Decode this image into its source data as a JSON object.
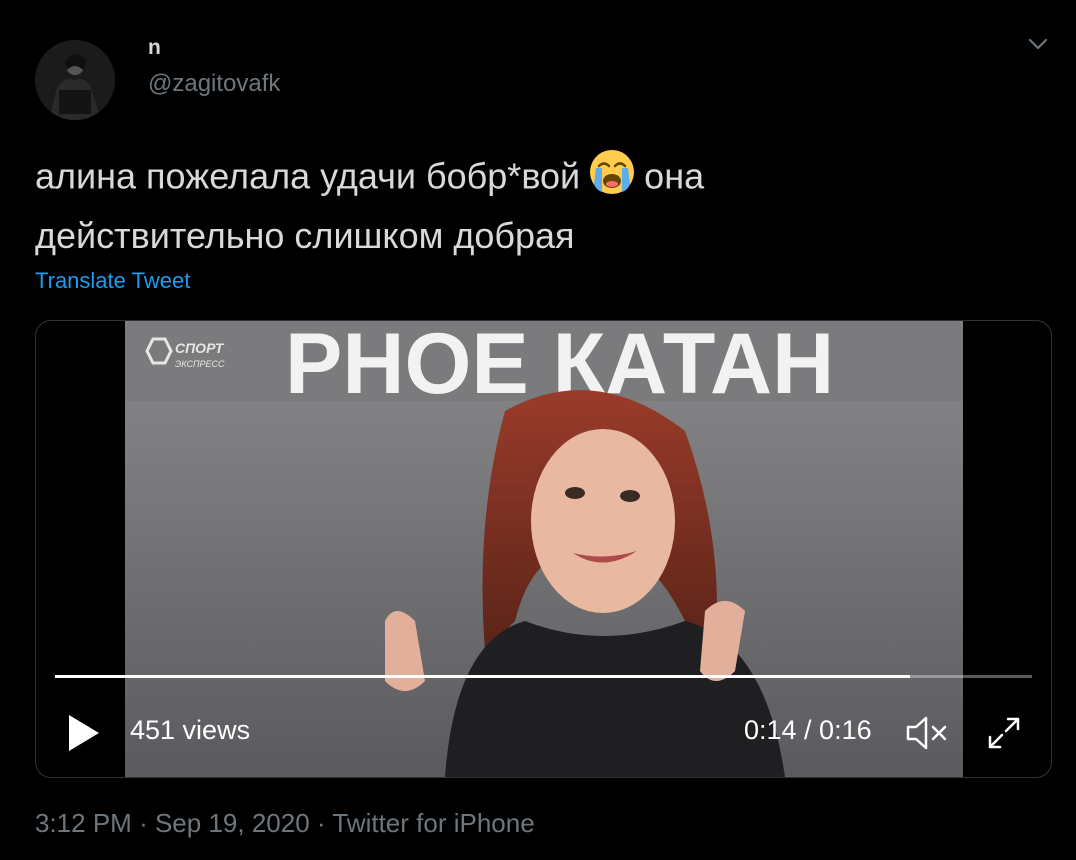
{
  "author": {
    "display_name": "n",
    "handle": "@zagitovafk"
  },
  "tweet": {
    "line1_before": "алина пожелала удачи бобр*вой",
    "emoji": "loudly-crying-face-icon",
    "line1_after": "она",
    "line2": "действительно слишком добрая",
    "translate_label": "Translate Tweet"
  },
  "video": {
    "views_label": "451 views",
    "time_label": "0:14 / 0:16",
    "progress": 0.875,
    "overlay_text": "РНОЕ КАТАН",
    "logo_line1": "СПОРТ",
    "logo_line2": "ЭКСПРЕСС"
  },
  "meta": {
    "time": "3:12 PM",
    "date": "Sep 19, 2020",
    "source": "Twitter for iPhone",
    "separator": "·"
  },
  "colors": {
    "link": "#1d9bf0",
    "secondary": "#6e767d",
    "text": "#d9d9d9"
  }
}
